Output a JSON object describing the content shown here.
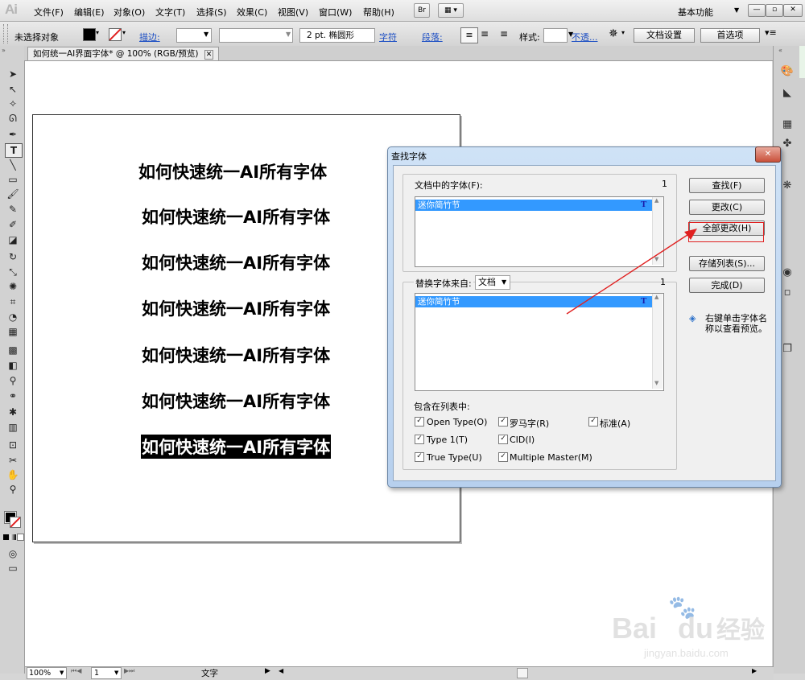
{
  "app": {
    "logo": "Ai"
  },
  "menu": {
    "items": [
      "文件(F)",
      "编辑(E)",
      "对象(O)",
      "文字(T)",
      "选择(S)",
      "效果(C)",
      "视图(V)",
      "窗口(W)",
      "帮助(H)"
    ],
    "bridge": "Br",
    "workspace": "基本功能",
    "workspace_arrow": "▼"
  },
  "control": {
    "selection": "未选择对象",
    "stroke_label": "描边:",
    "brush_size": "2 pt. 椭圆形",
    "char_label": "字符",
    "para_label": "段落:",
    "style_label": "样式:",
    "opacity_label": "不透...",
    "doc_setup": "文档设置",
    "prefs": "首选项"
  },
  "document": {
    "tab_title": "如何统一AI界面字体* @ 100% (RGB/预览)"
  },
  "artboard": {
    "lines": [
      "如何快速统一AI所有字体",
      "如何快速统一AI所有字体",
      "如何快速统一AI所有字体",
      "如何快速统一AI所有字体",
      "如何快速统一AI所有字体",
      "如何快速统一AI所有字体",
      "如何快速统一AI所有字体"
    ]
  },
  "dialog": {
    "title": "查找字体",
    "doc_fonts_label": "文档中的字体(F):",
    "doc_fonts_count": "1",
    "doc_fonts": [
      "迷你简竹节"
    ],
    "replace_label": "替换字体来自:",
    "replace_source": "文档",
    "replace_count": "1",
    "replace_fonts": [
      "迷你简竹节"
    ],
    "include_label": "包含在列表中:",
    "checkboxes": [
      {
        "label": "Open Type(O)",
        "checked": true
      },
      {
        "label": "罗马字(R)",
        "checked": true
      },
      {
        "label": "标准(A)",
        "checked": true
      },
      {
        "label": "Type 1(T)",
        "checked": true
      },
      {
        "label": "CID(I)",
        "checked": true
      },
      {
        "label": "True Type(U)",
        "checked": true
      },
      {
        "label": "Multiple Master(M)",
        "checked": true
      }
    ],
    "buttons": {
      "find": "查找(F)",
      "change": "更改(C)",
      "change_all": "全部更改(H)",
      "save_list": "存储列表(S)...",
      "done": "完成(D)"
    },
    "hint": "右键单击字体名称以查看预览。",
    "font_type_icon": "T"
  },
  "status": {
    "zoom": "100%",
    "page": "1",
    "tool": "文字"
  },
  "watermark": {
    "brand": "Bai",
    "brand2": "du",
    "cn": "经验",
    "url": "jingyan.baidu.com"
  },
  "colors": {
    "accent": "#3399ff",
    "annotation": "#e02020",
    "link": "#1d4fc4"
  }
}
